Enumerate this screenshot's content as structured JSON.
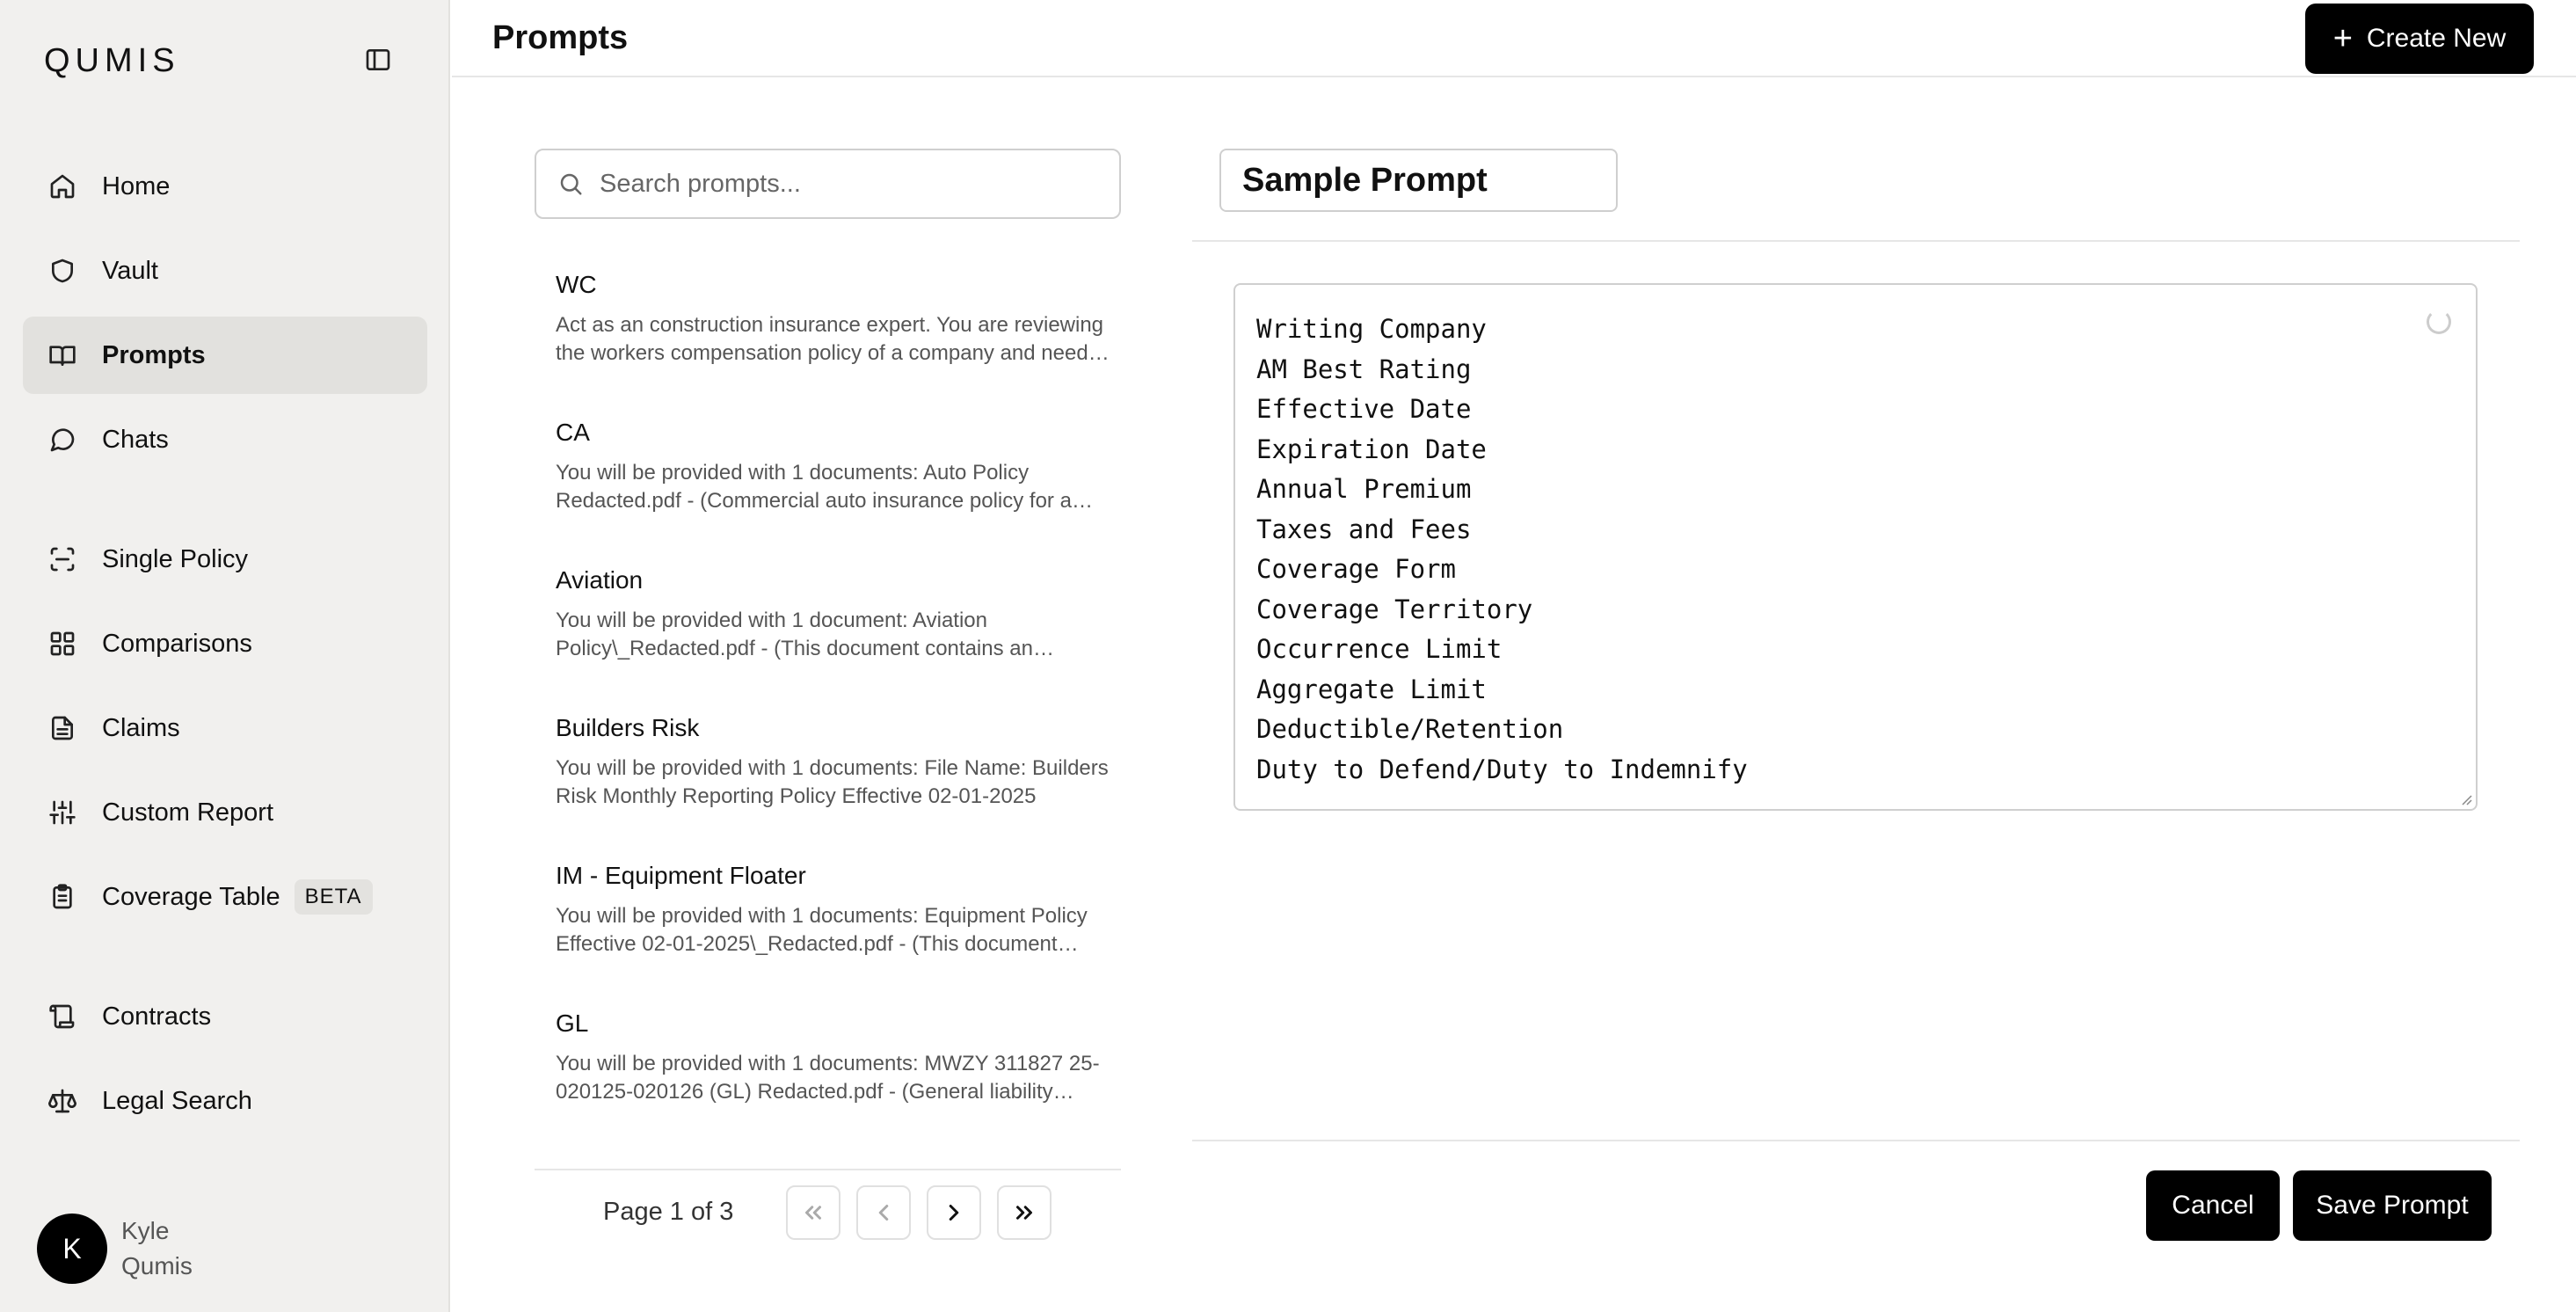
{
  "sidebar": {
    "logo": "QUMIS",
    "items": [
      {
        "label": "Home",
        "icon": "home-icon",
        "active": false
      },
      {
        "label": "Vault",
        "icon": "shield-icon",
        "active": false
      },
      {
        "label": "Prompts",
        "icon": "book-open-icon",
        "active": true
      },
      {
        "label": "Chats",
        "icon": "chat-bubble-icon",
        "active": false
      },
      {
        "label": "Single Policy",
        "icon": "scan-icon",
        "active": false
      },
      {
        "label": "Comparisons",
        "icon": "grid-icon",
        "active": false
      },
      {
        "label": "Claims",
        "icon": "file-text-icon",
        "active": false
      },
      {
        "label": "Custom Report",
        "icon": "sliders-icon",
        "active": false
      },
      {
        "label": "Coverage Table",
        "icon": "clipboard-list-icon",
        "active": false,
        "badge": "BETA"
      },
      {
        "label": "Contracts",
        "icon": "scroll-icon",
        "active": false
      },
      {
        "label": "Legal Search",
        "icon": "scale-icon",
        "active": false
      }
    ],
    "user": {
      "initial": "K",
      "first_name": "Kyle",
      "last_name": "Qumis"
    }
  },
  "header": {
    "title": "Prompts",
    "create_label": "Create New"
  },
  "search": {
    "placeholder": "Search prompts..."
  },
  "prompts": [
    {
      "title": "WC",
      "description": "Act as an construction insurance expert. You are reviewing the workers compensation policy of a company and need to extract the key coverage details."
    },
    {
      "title": "CA",
      "description": "You will be provided with 1 documents: Auto Policy Redacted.pdf - (Commercial auto insurance policy for a construction company)"
    },
    {
      "title": "Aviation",
      "description": "You will be provided with 1 document: Aviation Policy\\_Redacted.pdf - (This document contains an aviation insurance policy)"
    },
    {
      "title": "Builders Risk",
      "description": "You will be provided with 1 documents: File Name: Builders Risk Monthly Reporting Policy Effective 02-01-2025"
    },
    {
      "title": "IM - Equipment Floater",
      "description": "You will be provided with 1 documents: Equipment Policy Effective 02-01-2025\\_Redacted.pdf - (This document contains an inland marine policy)"
    },
    {
      "title": "GL",
      "description": "You will be provided with 1 documents: MWZY 311827 25-020125-020126 (GL) Redacted.pdf - (General liability insurance policy)"
    }
  ],
  "pagination": {
    "label": "Page 1 of 3",
    "current": 1,
    "total": 3
  },
  "editor": {
    "title_value": "Sample Prompt",
    "body": "Writing Company\nAM Best Rating\nEffective Date\nExpiration Date\nAnnual Premium\nTaxes and Fees\nCoverage Form\nCoverage Territory\nOccurrence Limit\nAggregate Limit\nDeductible/Retention\nDuty to Defend/Duty to Indemnify",
    "cancel_label": "Cancel",
    "save_label": "Save Prompt"
  }
}
